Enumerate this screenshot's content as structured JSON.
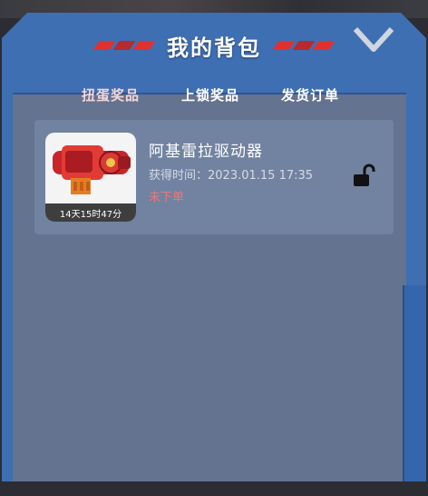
{
  "header": {
    "title": "我的背包"
  },
  "tabs": [
    {
      "label": "扭蛋奖品",
      "active": true
    },
    {
      "label": "上锁奖品",
      "active": false
    },
    {
      "label": "发货订单",
      "active": false
    }
  ],
  "items": [
    {
      "name": "阿基雷拉驱动器",
      "time_label": "获得时间：",
      "time_value": "2023.01.15 17:35",
      "status": "未下单",
      "countdown": "14天15时47分"
    }
  ],
  "icons": {
    "close": "chevron-down-icon",
    "lock": "unlocked-padlock-icon"
  },
  "colors": {
    "panel": "#3f6fb3",
    "inner": "#64738f",
    "card": "#7183a0",
    "accent": "#e0312e",
    "status": "#e87a7c"
  }
}
